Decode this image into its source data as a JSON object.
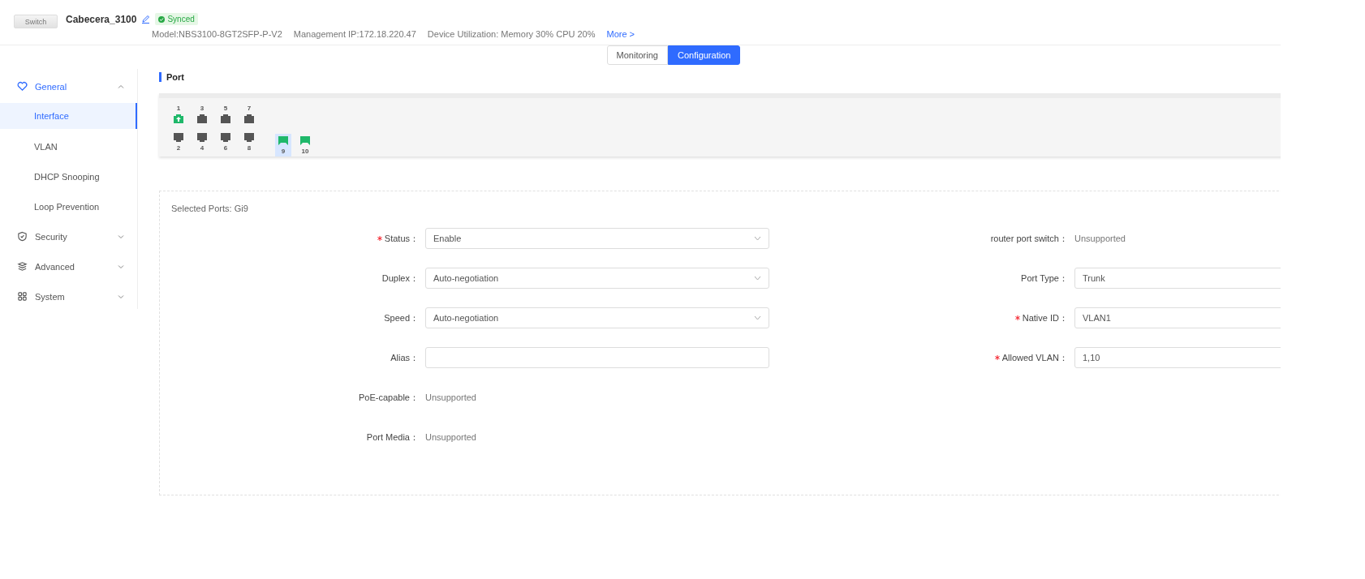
{
  "device": {
    "image_label": "Switch",
    "name": "Cabecera_3100",
    "sync_status": "Synced",
    "model": "Model:NBS3100-8GT2SFP-P-V2",
    "management_ip": "Management IP:172.18.220.47",
    "utilization": "Device Utilization: Memory 30% CPU 20%",
    "more_link": "More >"
  },
  "tabs": [
    {
      "label": "Monitoring",
      "selected": false
    },
    {
      "label": "Configuration",
      "selected": true
    }
  ],
  "sidebar": {
    "items": [
      {
        "label": "General",
        "expanded": true,
        "children": [
          {
            "label": "Interface",
            "selected": true
          },
          {
            "label": "VLAN",
            "selected": false
          },
          {
            "label": "DHCP Snooping",
            "selected": false
          },
          {
            "label": "Loop Prevention",
            "selected": false
          }
        ]
      },
      {
        "label": "Security",
        "expanded": false
      },
      {
        "label": "Advanced",
        "expanded": false
      },
      {
        "label": "System",
        "expanded": false
      }
    ]
  },
  "section_title": "Port",
  "ports": [
    {
      "number": "1",
      "kind": "rj45",
      "link_up": true,
      "uplink": true,
      "selected": false
    },
    {
      "number": "2",
      "kind": "rj45",
      "link_up": false,
      "uplink": false,
      "selected": false
    },
    {
      "number": "3",
      "kind": "rj45",
      "link_up": false,
      "uplink": false,
      "selected": false
    },
    {
      "number": "4",
      "kind": "rj45",
      "link_up": false,
      "uplink": false,
      "selected": false
    },
    {
      "number": "5",
      "kind": "rj45",
      "link_up": false,
      "uplink": false,
      "selected": false
    },
    {
      "number": "6",
      "kind": "rj45",
      "link_up": false,
      "uplink": false,
      "selected": false
    },
    {
      "number": "7",
      "kind": "rj45",
      "link_up": false,
      "uplink": false,
      "selected": false
    },
    {
      "number": "8",
      "kind": "rj45",
      "link_up": false,
      "uplink": false,
      "selected": false
    },
    {
      "number": "9",
      "kind": "sfp",
      "link_up": true,
      "uplink": false,
      "selected": true
    },
    {
      "number": "10",
      "kind": "sfp",
      "link_up": true,
      "uplink": false,
      "selected": false
    }
  ],
  "form": {
    "selected_ports": "Selected Ports: Gi9",
    "left_fields": [
      {
        "label": "Status：",
        "required": true,
        "kind": "select",
        "value": "Enable"
      },
      {
        "label": "Duplex：",
        "required": false,
        "kind": "select",
        "value": "Auto-negotiation"
      },
      {
        "label": "Speed：",
        "required": false,
        "kind": "select",
        "value": "Auto-negotiation"
      },
      {
        "label": "Alias：",
        "required": false,
        "kind": "input"
      },
      {
        "label": "PoE-capable：",
        "required": false,
        "kind": "text",
        "value": "Unsupported"
      },
      {
        "label": "Port Media：",
        "required": false,
        "kind": "text",
        "value": "Unsupported"
      }
    ],
    "right_fields": [
      {
        "label": "router port switch：",
        "required": false,
        "kind": "text",
        "value": "Unsupported"
      },
      {
        "label": "Port Type：",
        "required": false,
        "kind": "input",
        "value": "Trunk"
      },
      {
        "label": "Native ID：",
        "required": true,
        "kind": "input",
        "value": "VLAN1"
      },
      {
        "label": "Allowed VLAN：",
        "required": true,
        "kind": "input",
        "value": "1,10"
      }
    ]
  }
}
